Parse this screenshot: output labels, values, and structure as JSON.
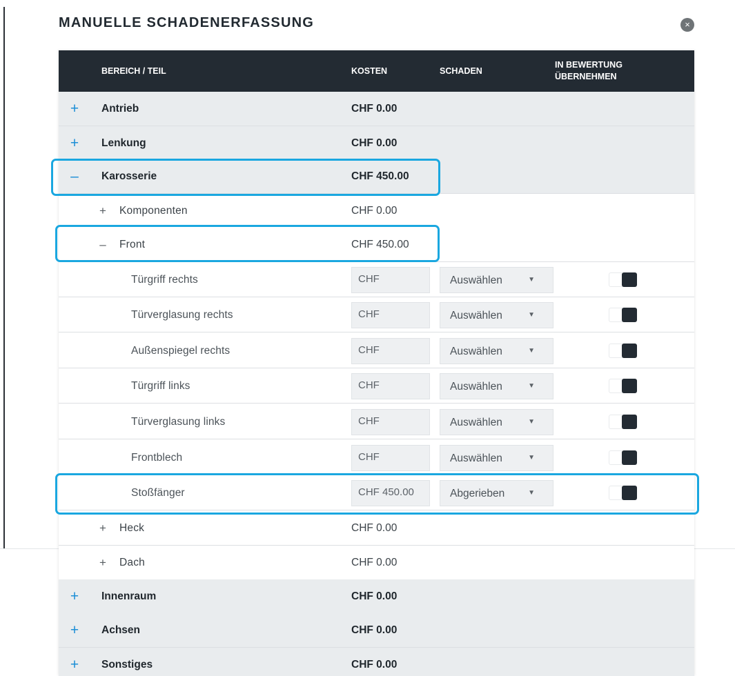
{
  "dialog": {
    "title": "MANUELLE SCHADENERFASSUNG",
    "close_glyph": "×"
  },
  "table": {
    "headers": {
      "bereich": "BEREICH / TEIL",
      "kosten": "KOSTEN",
      "schaden": "SCHADEN",
      "uebernehmen_line1": "IN BEWERTUNG",
      "uebernehmen_line2": "ÜBERNEHMEN"
    },
    "rows": [
      {
        "type": "main",
        "toggle": "+",
        "label": "Antrieb",
        "cost": "CHF 0.00"
      },
      {
        "type": "main",
        "toggle": "+",
        "label": "Lenkung",
        "cost": "CHF 0.00"
      },
      {
        "type": "main",
        "toggle": "–",
        "label": "Karosserie",
        "cost": "CHF 450.00"
      },
      {
        "type": "sub",
        "toggle": "+",
        "label": "Komponenten",
        "cost": "CHF 0.00"
      },
      {
        "type": "sub",
        "toggle": "–",
        "label": "Front",
        "cost": "CHF 450.00"
      },
      {
        "type": "item",
        "label": "Türgriff rechts",
        "cost_value": "",
        "cost_placeholder": "CHF",
        "damage": "Auswählen",
        "take_over": true
      },
      {
        "type": "item",
        "label": "Türverglasung rechts",
        "cost_value": "",
        "cost_placeholder": "CHF",
        "damage": "Auswählen",
        "take_over": true
      },
      {
        "type": "item",
        "label": "Außenspiegel rechts",
        "cost_value": "",
        "cost_placeholder": "CHF",
        "damage": "Auswählen",
        "take_over": true
      },
      {
        "type": "item",
        "label": "Türgriff links",
        "cost_value": "",
        "cost_placeholder": "CHF",
        "damage": "Auswählen",
        "take_over": true
      },
      {
        "type": "item",
        "label": "Türverglasung links",
        "cost_value": "",
        "cost_placeholder": "CHF",
        "damage": "Auswählen",
        "take_over": true
      },
      {
        "type": "item",
        "label": "Frontblech",
        "cost_value": "",
        "cost_placeholder": "CHF",
        "damage": "Auswählen",
        "take_over": true
      },
      {
        "type": "item",
        "label": "Stoßfänger",
        "cost_value": "CHF 450.00",
        "cost_placeholder": "CHF",
        "damage": "Abgerieben",
        "take_over": true
      },
      {
        "type": "sub",
        "toggle": "+",
        "label": "Heck",
        "cost": "CHF 0.00"
      },
      {
        "type": "sub",
        "toggle": "+",
        "label": "Dach",
        "cost": "CHF 0.00"
      },
      {
        "type": "main",
        "toggle": "+",
        "label": "Innenraum",
        "cost": "CHF 0.00"
      },
      {
        "type": "main",
        "toggle": "+",
        "label": "Achsen",
        "cost": "CHF 0.00"
      },
      {
        "type": "main",
        "toggle": "+",
        "label": "Sonstiges",
        "cost": "CHF 0.00"
      }
    ]
  },
  "colors": {
    "header_bg": "#232b33",
    "accent_plus": "#1c8ed6",
    "highlight": "#1aa7e0"
  }
}
